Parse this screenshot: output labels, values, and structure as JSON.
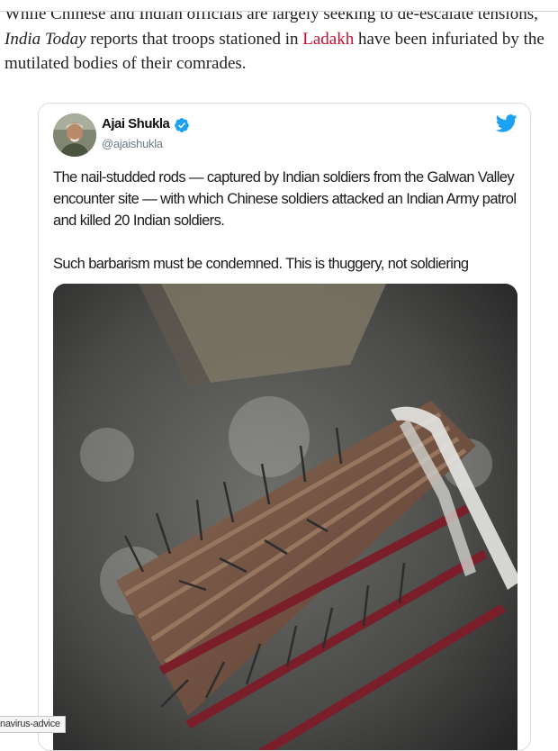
{
  "article": {
    "text_before_pub": "While Chinese and Indian officials are largely seeking to de-escalate tensions, ",
    "publication": "India Today",
    "text_middle": " reports that troops stationed in ",
    "link_text": "Ladakh",
    "text_after_link": " have been infuriated by the mutilated bodies of their comrades."
  },
  "tweet": {
    "author_name": "Ajai Shukla",
    "handle": "@ajaishukla",
    "paragraph_1": "The nail-studded rods — captured by Indian soldiers from the Galwan Valley encounter site — with which Chinese soldiers attacked an Indian Army patrol and killed 20 Indian soldiers.",
    "paragraph_2": "Such barbarism must be condemned. This is thuggery, not soldiering",
    "photo_alt": "Nail-studded rods",
    "verified_icon": "verified-badge-icon",
    "brand_icon": "twitter-bird-icon"
  },
  "status_bar": {
    "url_fragment": "navirus-advice"
  },
  "colors": {
    "link": "#c8102e",
    "twitter_blue": "#1da1f2",
    "body_text": "#222222"
  }
}
